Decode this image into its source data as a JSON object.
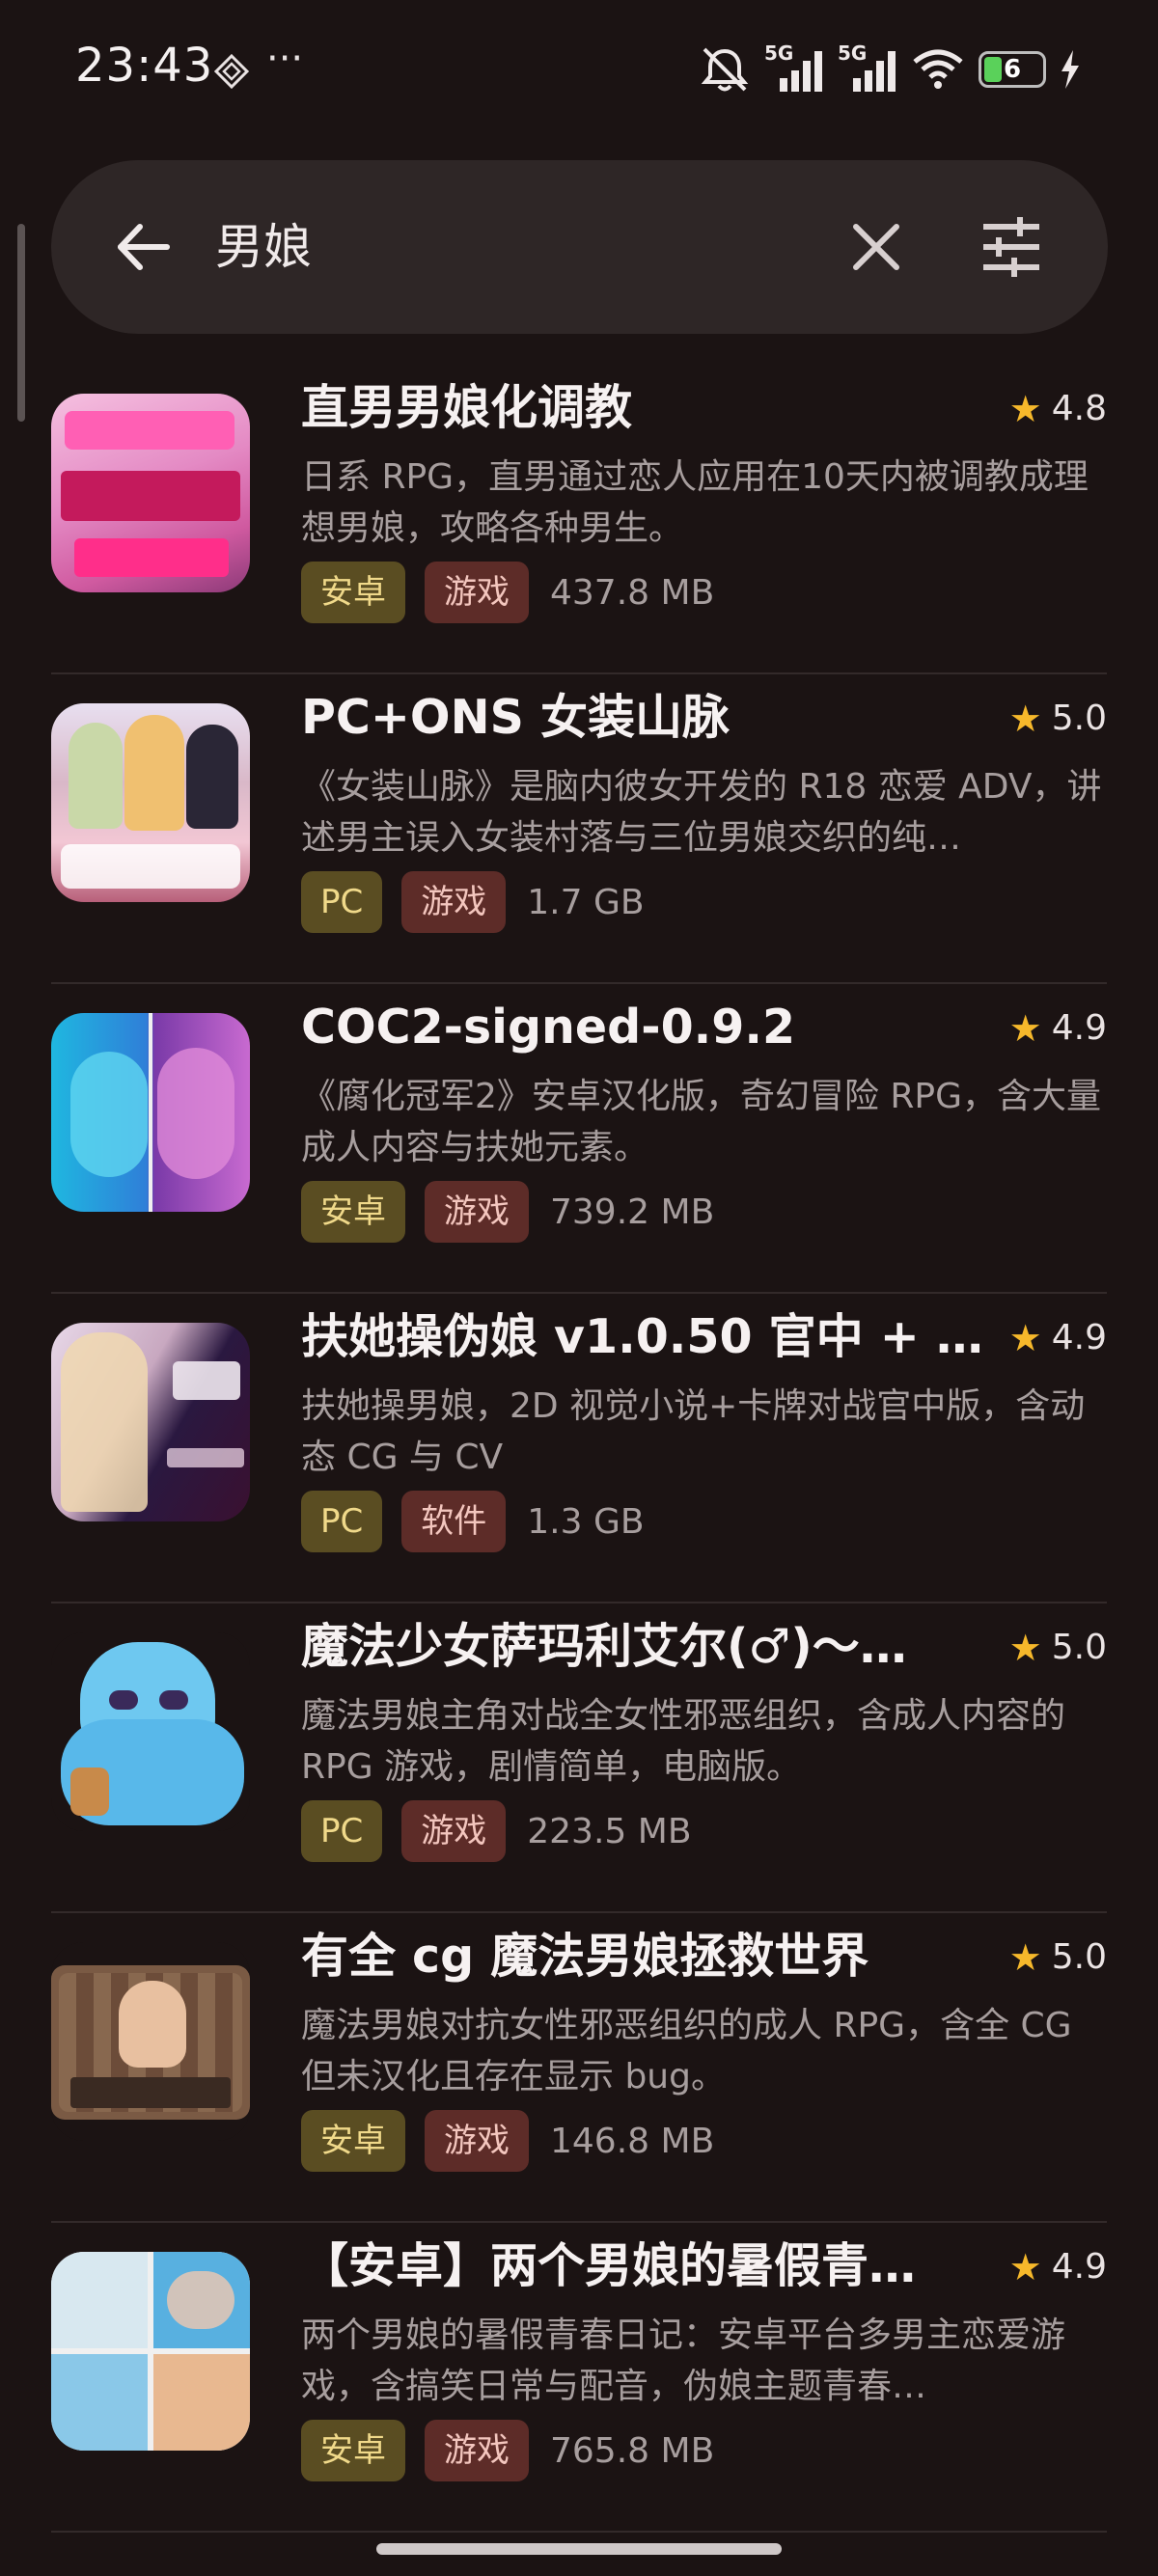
{
  "status_bar": {
    "time": "23:43",
    "more": "···",
    "battery_level": "6",
    "network_1": "5G",
    "network_2": "5G",
    "icons": [
      "diamond-icon",
      "mute-bell-icon",
      "signal-icon",
      "wifi-icon",
      "battery-icon",
      "charging-icon"
    ]
  },
  "search": {
    "query": "男娘",
    "icons": [
      "back-arrow-icon",
      "clear-icon",
      "filter-sliders-icon"
    ]
  },
  "colors": {
    "background": "#1b1313",
    "search_bg": "#2e2626",
    "star": "#f6b82b",
    "tag_platform_bg": "#5a4d22",
    "tag_category_bg": "#5d2c28"
  },
  "results": [
    {
      "title": "直男男娘化调教",
      "rating": "4.8",
      "desc": "日系 RPG，直男通过恋人应用在10天内被调教成理想男娘，攻略各种男生。",
      "platform": "安卓",
      "category": "游戏",
      "size": "437.8 MB"
    },
    {
      "title": "PC+ONS 女装山脉",
      "rating": "5.0",
      "desc": "《女装山脉》是脑内彼女开发的 R18 恋爱 ADV，讲述男主误入女装村落与三位男娘交织的纯…",
      "platform": "PC",
      "category": "游戏",
      "size": "1.7 GB"
    },
    {
      "title": "COC2-signed-0.9.2",
      "rating": "4.9",
      "desc": "《腐化冠军2》安卓汉化版，奇幻冒险 RPG，含大量成人内容与扶她元素。",
      "platform": "安卓",
      "category": "游戏",
      "size": "739.2 MB"
    },
    {
      "title": "扶她操伪娘 v1.0.50 官中 + A…",
      "rating": "4.9",
      "desc": "扶她操男娘，2D 视觉小说+卡牌对战官中版，含动态 CG 与 CV",
      "platform": "PC",
      "category": "软件",
      "size": "1.3 GB"
    },
    {
      "title": "魔法少女萨玛利艾尔(♂)～…",
      "rating": "5.0",
      "desc": "魔法男娘主角对战全女性邪恶组织，含成人内容的 RPG 游戏，剧情简单，电脑版。",
      "platform": "PC",
      "category": "游戏",
      "size": "223.5 MB"
    },
    {
      "title": "有全 cg 魔法男娘拯救世界",
      "rating": "5.0",
      "desc": "魔法男娘对抗女性邪恶组织的成人 RPG，含全 CG 但未汉化且存在显示 bug。",
      "platform": "安卓",
      "category": "游戏",
      "size": "146.8 MB"
    },
    {
      "title": "【安卓】两个男娘的暑假青…",
      "rating": "4.9",
      "desc": "两个男娘的暑假青春日记：安卓平台多男主恋爱游戏，含搞笑日常与配音，伪娘主题青春…",
      "platform": "安卓",
      "category": "游戏",
      "size": "765.8 MB"
    }
  ]
}
